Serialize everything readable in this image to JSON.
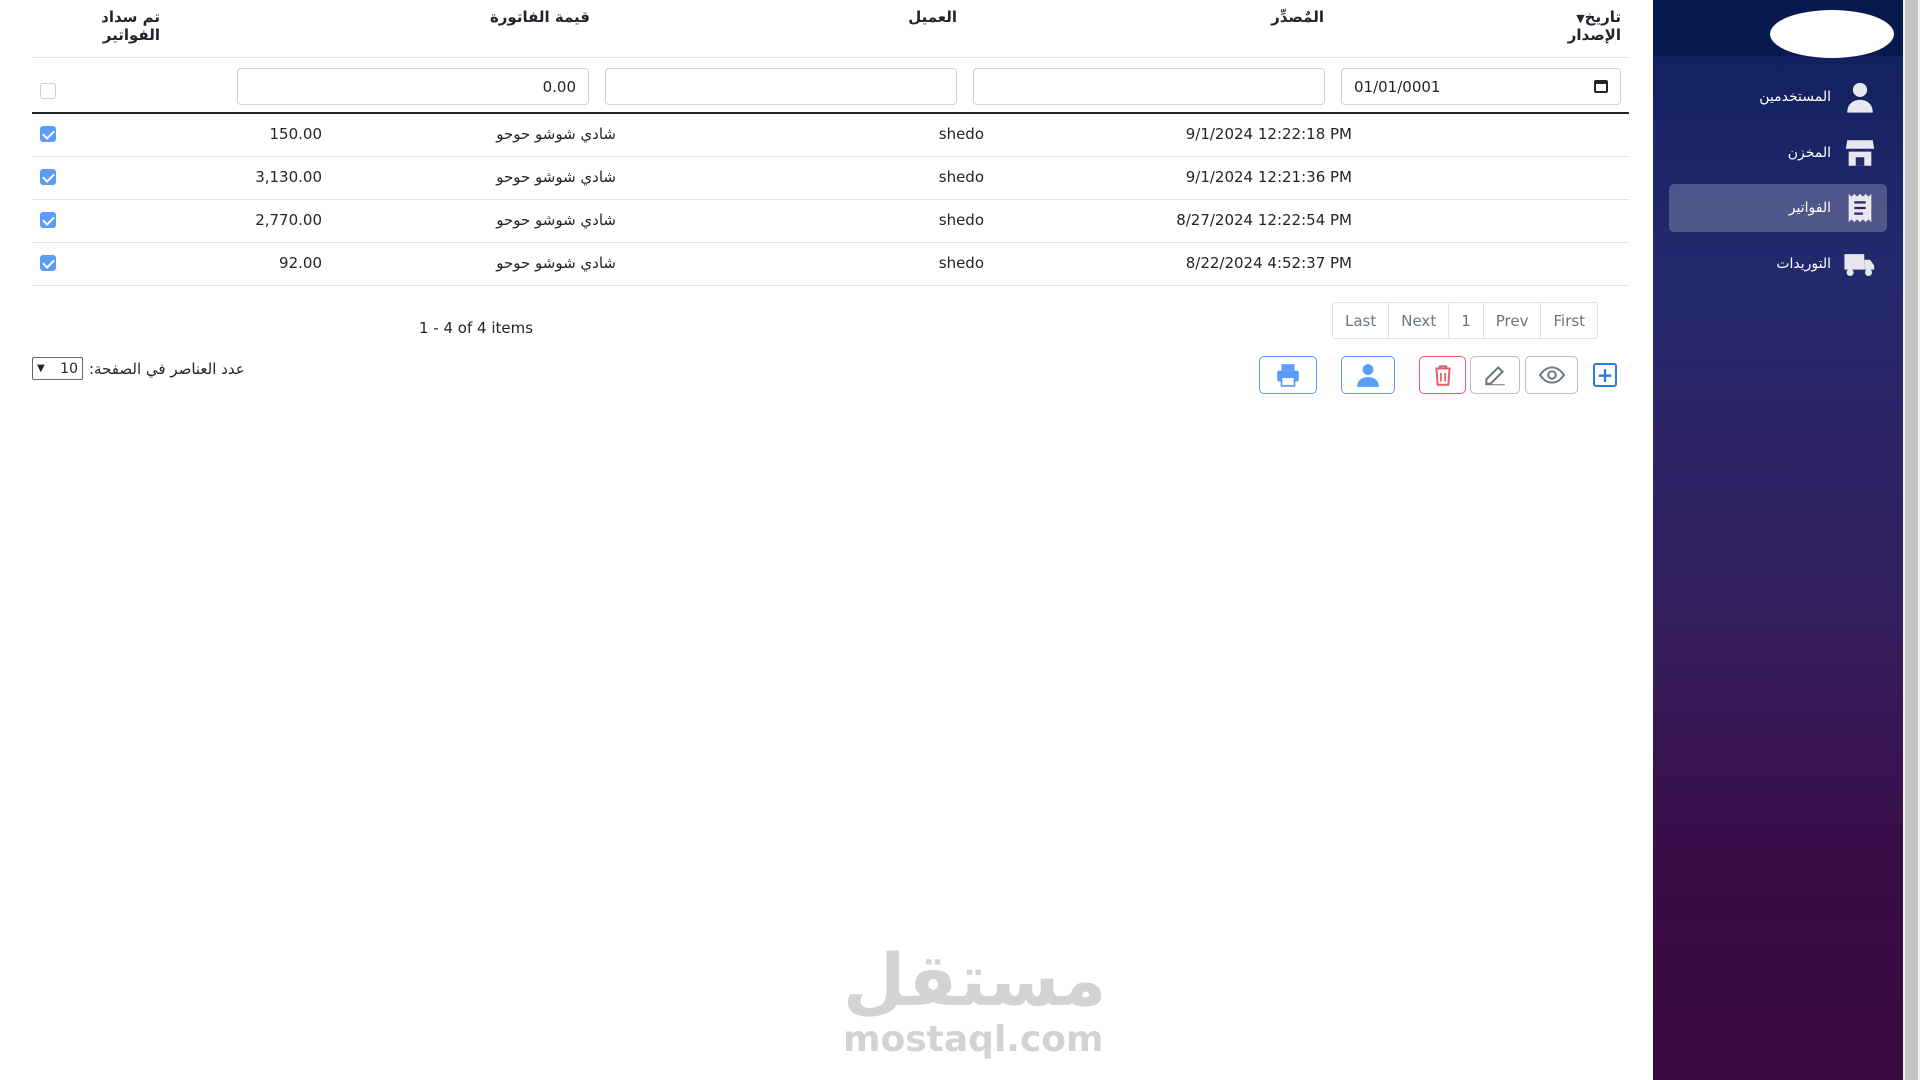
{
  "sidebar": {
    "items": [
      {
        "label": "المستخدمين",
        "icon": "user-icon"
      },
      {
        "label": "المخزن",
        "icon": "store-icon"
      },
      {
        "label": "الفواتير",
        "icon": "receipt-icon",
        "active": true
      },
      {
        "label": "التوريدات",
        "icon": "truck-icon"
      }
    ]
  },
  "grid": {
    "headers": {
      "date": "تاريخ الإصدار",
      "issuer": "المٌصدِّر",
      "client": "العميل",
      "amount": "قيمة الفاتورة",
      "paid": "تم سداد الفواتير"
    },
    "filters": {
      "date": "01/01/0001",
      "issuer": "",
      "client": "",
      "amount": "0.00",
      "paid": false
    },
    "rows": [
      {
        "date": "9/1/2024 12:22:18 PM",
        "issuer": "shedo",
        "client": "شادي شوشو حوحو",
        "amount": "150.00",
        "paid": true
      },
      {
        "date": "9/1/2024 12:21:36 PM",
        "issuer": "shedo",
        "client": "شادي شوشو حوحو",
        "amount": "3,130.00",
        "paid": true
      },
      {
        "date": "8/27/2024 12:22:54 PM",
        "issuer": "shedo",
        "client": "شادي شوشو حوحو",
        "amount": "2,770.00",
        "paid": true
      },
      {
        "date": "8/22/2024 4:52:37 PM",
        "issuer": "shedo",
        "client": "شادي شوشو حوحو",
        "amount": "92.00",
        "paid": true
      }
    ]
  },
  "pager": {
    "first": "First",
    "prev": "Prev",
    "page": "1",
    "next": "Next",
    "last": "Last",
    "info": "1 - 4 of 4 items",
    "page_size_label": "عدد العناصر في الصفحة:",
    "page_size": "10"
  },
  "toolbar": {
    "add": "plus-square-icon",
    "view": "eye-icon",
    "edit": "pencil-icon",
    "delete": "trash-icon",
    "client": "person-icon",
    "print": "printer-icon"
  },
  "watermark": {
    "arabic": "مستقل",
    "latin": "mostaql.com"
  },
  "colors": {
    "accent": "#5a9cf8",
    "danger": "#e35d6a",
    "sidebar_top": "#071a4e",
    "sidebar_bottom": "#3c0a42"
  }
}
